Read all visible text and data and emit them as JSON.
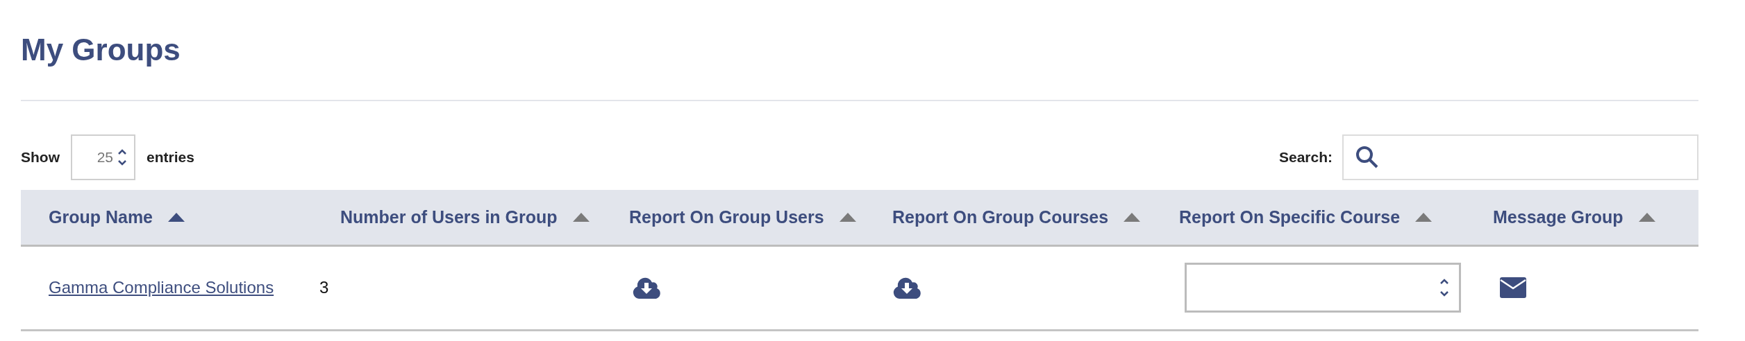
{
  "title": "My Groups",
  "length_control": {
    "label_before": "Show",
    "value": "25",
    "label_after": "entries"
  },
  "search": {
    "label": "Search:"
  },
  "table": {
    "columns": [
      {
        "label": "Group Name",
        "sort_active": true
      },
      {
        "label": "Number of Users in Group",
        "sort_active": false
      },
      {
        "label": "Report On Group Users",
        "sort_active": false
      },
      {
        "label": "Report On Group Courses",
        "sort_active": false
      },
      {
        "label": "Report On Specific Course",
        "sort_active": false
      },
      {
        "label": "Message Group",
        "sort_active": false
      }
    ],
    "rows": [
      {
        "group_name": "Gamma Compliance Solutions",
        "user_count": "3"
      }
    ]
  }
}
